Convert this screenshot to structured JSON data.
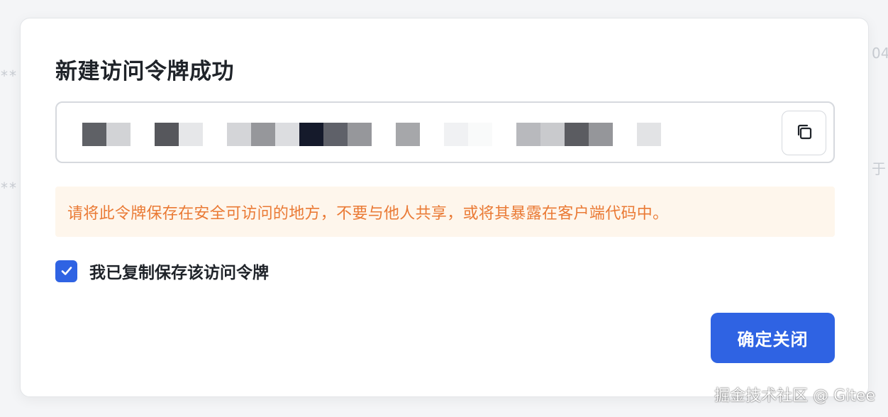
{
  "background": {
    "left_fragment_1": "**",
    "left_fragment_2": "**",
    "right_fragment_1": "04",
    "right_fragment_2": "于"
  },
  "modal": {
    "title": "新建访问令牌成功",
    "token": {
      "pixel_colors": [
        "#5f6166",
        "#d2d3d6",
        "#56575c",
        "#e6e7e9",
        "#d4d5d8",
        "#96979b",
        "#dcdde0",
        "#151a2b",
        "#5f6169",
        "#96979b",
        "#a6a7aa",
        "#f0f1f3",
        "#f9fafa",
        "#b8b9bd",
        "#c9cacd",
        "#5b5c61",
        "#95969a",
        "#e2e3e5"
      ],
      "copy_icon": "copy-icon"
    },
    "warning": "请将此令牌保存在安全可访问的地方，不要与他人共享，或将其暴露在客户端代码中。",
    "confirm_checkbox": {
      "checked": true,
      "label": "我已复制保存该访问令牌"
    },
    "close_button": "确定关闭"
  },
  "watermark": "掘金技术社区 @ Gitee",
  "colors": {
    "primary": "#2f63e3",
    "warning_text": "#ea7a35",
    "warning_bg": "#fef6ec"
  }
}
